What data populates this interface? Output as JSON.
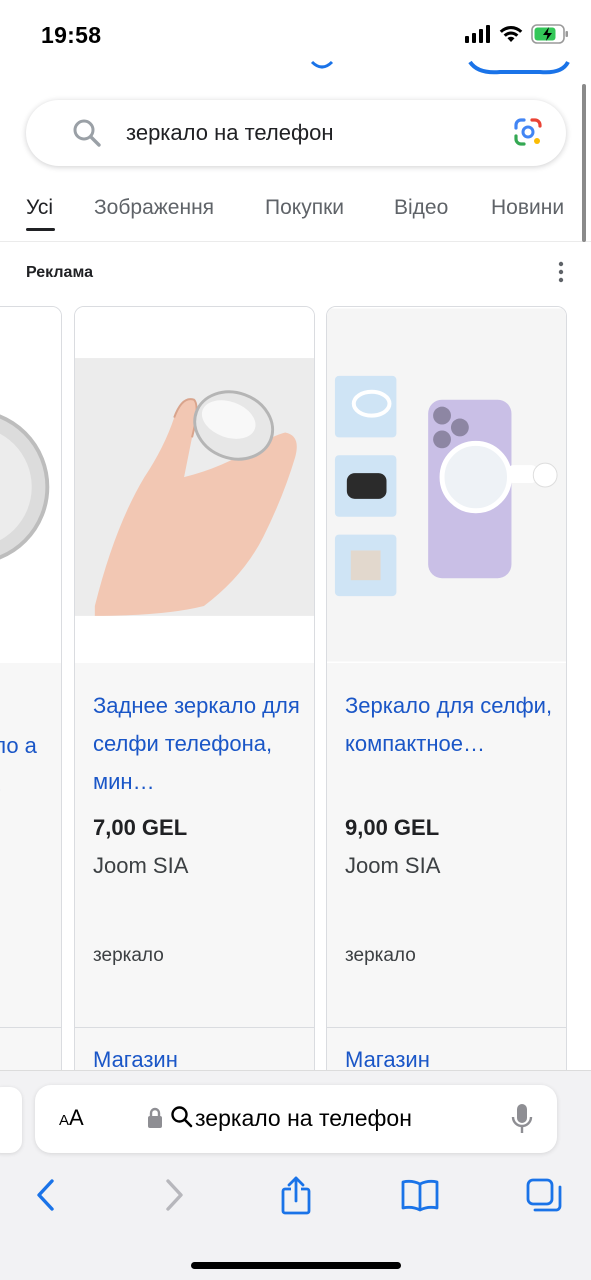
{
  "status_bar": {
    "time": "19:58",
    "icons": [
      "signal-icon",
      "wifi-icon",
      "battery-charging-icon"
    ]
  },
  "search": {
    "query": "зеркало на телефон",
    "icons": [
      "search-icon",
      "google-lens-icon"
    ]
  },
  "tabs": [
    {
      "label": "Усі",
      "active": true
    },
    {
      "label": "Зображення",
      "active": false
    },
    {
      "label": "Покупки",
      "active": false
    },
    {
      "label": "Відео",
      "active": false
    },
    {
      "label": "Новини",
      "active": false
    }
  ],
  "ads": {
    "label": "Реклама",
    "products": [
      {
        "title_fragment": "ало а …",
        "partial": true
      },
      {
        "title": "Заднее зеркало для селфи телефона, мин…",
        "price": "7,00 GEL",
        "merchant": "Joom SIA",
        "tag": "зеркало",
        "store_link": "Магазин"
      },
      {
        "title": "Зеркало для селфи, компактное…",
        "price": "9,00 GEL",
        "merchant": "Joom SIA",
        "tag": "зеркало",
        "store_link": "Магазин"
      }
    ]
  },
  "safari": {
    "aa_label": "AA",
    "address_text": "зеркало на телефон",
    "toolbar": [
      "back-icon",
      "forward-icon",
      "share-icon",
      "bookmarks-icon",
      "tabs-icon"
    ]
  },
  "colors": {
    "link_blue": "#1a56c7",
    "text_dark": "#202124",
    "text_grey": "#5f6368",
    "safari_bg": "#f2f2f4",
    "toolbar_blue": "#1a73e8"
  }
}
